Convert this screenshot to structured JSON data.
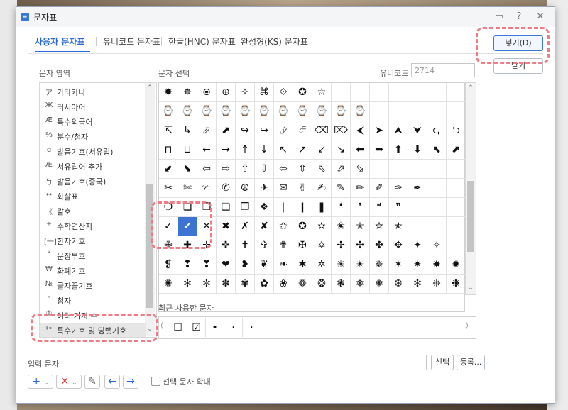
{
  "window": {
    "title": "문자표",
    "help": "?",
    "close": "✕"
  },
  "tabs": [
    "사용자 문자표",
    "유니코드 문자표",
    "한글(HNC) 문자표",
    "완성형(KS) 문자표"
  ],
  "buttons": {
    "insert": "넣기(D)",
    "close": "닫기",
    "select": "선택",
    "register": "등록..."
  },
  "labels": {
    "char_area": "문자 영역",
    "char_select": "문자 선택",
    "unicode_label": "유니코드",
    "recent": "최근 사용한 문자",
    "input_char": "입력 문자",
    "zoom_selected": "선택 문자 확대"
  },
  "unicode_value": "2714",
  "areas": [
    {
      "icon": "ア",
      "label": "가타카나"
    },
    {
      "icon": "Ж",
      "label": "러시아어"
    },
    {
      "icon": "Æ",
      "label": "특수외국어"
    },
    {
      "icon": "⅔",
      "label": "분수/첨자"
    },
    {
      "icon": "ɑ",
      "label": "발음기호(서유럽)"
    },
    {
      "icon": "Æ",
      "label": "서유럽어 추가"
    },
    {
      "icon": "ㄅ",
      "label": "발음기호(중국)"
    },
    {
      "icon": "↔",
      "label": "화살표"
    },
    {
      "icon": "《",
      "label": "괄호"
    },
    {
      "icon": "±",
      "label": "수학연산자"
    },
    {
      "icon": "[一]",
      "label": "한자기호"
    },
    {
      "icon": "❝",
      "label": "문장부호"
    },
    {
      "icon": "₩",
      "label": "화폐기호"
    },
    {
      "icon": "№",
      "label": "글자꼴기호"
    },
    {
      "icon": "'",
      "label": "첨자"
    },
    {
      "icon": "①",
      "label": "여러 가지 수"
    },
    {
      "icon": "✂",
      "label": "특수기호 및 딩뱃기호"
    }
  ],
  "selected_area": "특수기호 및 딩뱃기호",
  "grid": [
    [
      "✹",
      "✵",
      "⊜",
      "⊕",
      "✧",
      "⌘",
      "⟐",
      "✪",
      "☆",
      "",
      "",
      "",
      "",
      "",
      "",
      ""
    ],
    [
      "⌚",
      "⌚",
      "⌚",
      "⌚",
      "⌚",
      "⌚",
      "⌚",
      "⌚",
      "⌚",
      "⌚",
      "⌚",
      "",
      "",
      "",
      "",
      ""
    ],
    [
      "⇱",
      "↳",
      "⬀",
      "⬈",
      "↬",
      "↪",
      "⮵",
      "⮶",
      "⌫",
      "⌦",
      "⮜",
      "➤",
      "⮝",
      "⮟",
      "⮎",
      "⮌"
    ],
    [
      "⊓",
      "⊔",
      "←",
      "→",
      "↑",
      "↓",
      "↖",
      "↗",
      "↙",
      "↘",
      "⬅",
      "➡",
      "⬆",
      "⬇",
      "⬉",
      "⬈"
    ],
    [
      "⬋",
      "⬊",
      "⇦",
      "⇨",
      "⇧",
      "⇩",
      "⬄",
      "⇳",
      "⬁",
      "⬀",
      "⬂",
      "",
      "",
      "",
      "",
      ""
    ],
    [
      "✂",
      "✄",
      "✃",
      "✆",
      "☮",
      "✈",
      "✉",
      "✌",
      "✍",
      "✎",
      "✏",
      "✐",
      "✑",
      "✒",
      "",
      ""
    ],
    [
      "❍",
      "❏",
      "❐",
      "❑",
      "❒",
      "❖",
      "❘",
      "❙",
      "❚",
      "❛",
      "❜",
      "❝",
      "❞",
      "",
      "",
      ""
    ],
    [
      "✓",
      "✔",
      "✕",
      "✖",
      "✗",
      "✘",
      "✩",
      "✪",
      "✫",
      "✬",
      "✭",
      "✮",
      "✯",
      "",
      "",
      ""
    ],
    [
      "✙",
      "✚",
      "✛",
      "✜",
      "✝",
      "✞",
      "✟",
      "✠",
      "✡",
      "✢",
      "✣",
      "✤",
      "✥",
      "✦",
      "✧",
      ""
    ],
    [
      "❡",
      "❢",
      "❣",
      "❤",
      "❥",
      "❦",
      "❧",
      "✱",
      "✲",
      "✳",
      "✴",
      "✵",
      "✶",
      "✷",
      "✸",
      "✹"
    ],
    [
      "✺",
      "✻",
      "✼",
      "✽",
      "✾",
      "✿",
      "❀",
      "❁",
      "❂",
      "❃",
      "❄",
      "❅",
      "❆",
      "❇",
      "❈",
      "❉"
    ]
  ],
  "selected_char": "✔",
  "recent_chars": [
    "☐",
    "☑",
    "•",
    "·",
    "·"
  ],
  "toolbar": {
    "add": "+",
    "delete": "✕",
    "edit": "✎",
    "left": "←",
    "right": "→",
    "dropdown": "⌄"
  },
  "colors": {
    "accent": "#2868d6",
    "highlight": "#f07b85",
    "selected_cell": "#3d73d3"
  },
  "icons": {
    "scroll_up": "⌃",
    "scroll_down": "⌄",
    "recent_prev": "⟨",
    "recent_next": "⟩"
  }
}
